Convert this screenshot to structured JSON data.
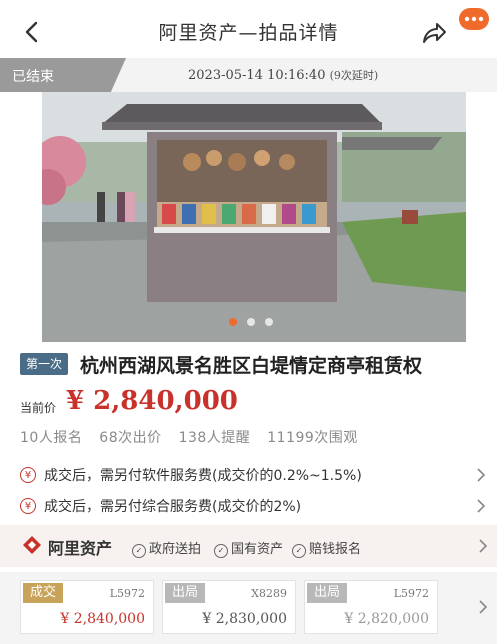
{
  "header": {
    "title": "阿里资产—拍品详情",
    "icons": {
      "back": "chevron-left-icon",
      "share": "share-icon",
      "more": "more-icon"
    },
    "accent_color": "#f06a2c"
  },
  "status": {
    "label": "已结束",
    "time": "2023-05-14 10:16:40",
    "extensions": "(9次延时)"
  },
  "gallery": {
    "slide_count": 3,
    "active_index": 0,
    "active_color": "#f06a2c"
  },
  "item": {
    "round_tag": "第一次",
    "title": "杭州西湖风景名胜区白堤情定商亭租赁权"
  },
  "price": {
    "label": "当前价",
    "value": "¥ 2,840,000",
    "color": "#c8322a"
  },
  "stats": [
    "10人报名",
    "68次出价",
    "138人提醒",
    "11199次围观"
  ],
  "fees": [
    {
      "icon": "yuan-icon",
      "text": "成交后，需另付软件服务费(成交价的0.2%~1.5%)"
    },
    {
      "icon": "yuan-icon",
      "text": "成交后，需另付综合服务费(成交价的2%)"
    }
  ],
  "brand": {
    "name": "阿里资产",
    "badges": [
      "政府送拍",
      "国有资产",
      "赔钱报名"
    ]
  },
  "records": [
    {
      "tag": "成交",
      "tag_color": "#c8a35a",
      "code": "L5972",
      "price": "¥ 2,840,000",
      "price_color": "#c8322a"
    },
    {
      "tag": "出局",
      "tag_color": "#b8b8b8",
      "code": "X8289",
      "price": "¥ 2,830,000",
      "price_color": "#555555"
    },
    {
      "tag": "出局",
      "tag_color": "#b8b8b8",
      "code": "L5972",
      "price": "¥ 2,820,000",
      "price_color": "#999999"
    }
  ]
}
